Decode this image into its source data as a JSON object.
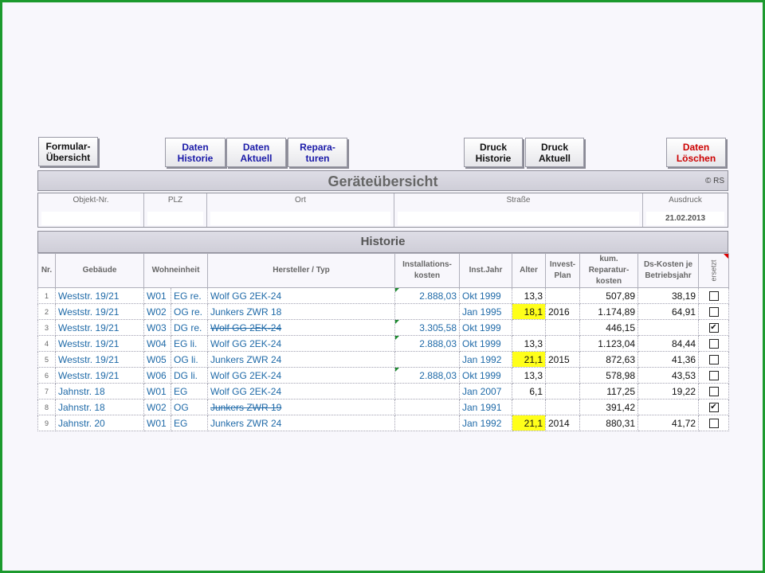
{
  "toolbar": {
    "formular": [
      "Formular-",
      "Übersicht"
    ],
    "daten_historie": [
      "Daten",
      "Historie"
    ],
    "daten_aktuell": [
      "Daten",
      "Aktuell"
    ],
    "reparaturen": [
      "Repara-",
      "turen"
    ],
    "druck_historie": [
      "Druck",
      "Historie"
    ],
    "druck_aktuell": [
      "Druck",
      "Aktuell"
    ],
    "daten_loeschen": [
      "Daten",
      "Löschen"
    ]
  },
  "title": "Geräteübersicht",
  "copyright": "© RS",
  "info": {
    "objekt_label": "Objekt-Nr.",
    "plz_label": "PLZ",
    "ort_label": "Ort",
    "strasse_label": "Straße",
    "ausdruck_label": "Ausdruck",
    "ausdruck_value": "21.02.2013"
  },
  "history_title": "Historie",
  "columns": {
    "nr": "Nr.",
    "gebaeude": "Gebäude",
    "wohneinheit": "Wohneinheit",
    "hersteller": "Hersteller / Typ",
    "installationskosten": [
      "Installations-",
      "kosten"
    ],
    "instjahr": "Inst.Jahr",
    "alter": "Alter",
    "invest": [
      "Invest-",
      "Plan"
    ],
    "kum": [
      "kum.",
      "Reparatur-",
      "kosten"
    ],
    "ds": [
      "Ds-Kosten je",
      "Betriebsjahr"
    ],
    "ersetzt": "ersetzt"
  },
  "rows": [
    {
      "nr": "1",
      "gebaeude": "Weststr. 19/21",
      "we": "W01",
      "lage": "EG re.",
      "hersteller": "Wolf GG 2EK-24",
      "strike": false,
      "install": "2.888,03",
      "instjahr": "Okt 1999",
      "alter": "13,3",
      "alter_hl": false,
      "invest": "",
      "kum": "507,89",
      "ds": "38,19",
      "ersetzt": false
    },
    {
      "nr": "2",
      "gebaeude": "Weststr. 19/21",
      "we": "W02",
      "lage": "OG re.",
      "hersteller": "Junkers ZWR 18",
      "strike": false,
      "install": "",
      "instjahr": "Jan 1995",
      "alter": "18,1",
      "alter_hl": true,
      "invest": "2016",
      "kum": "1.174,89",
      "ds": "64,91",
      "ersetzt": false
    },
    {
      "nr": "3",
      "gebaeude": "Weststr. 19/21",
      "we": "W03",
      "lage": "DG re.",
      "hersteller": "Wolf GG 2EK-24",
      "strike": true,
      "install": "3.305,58",
      "instjahr": "Okt 1999",
      "alter": "",
      "alter_hl": false,
      "invest": "",
      "kum": "446,15",
      "ds": "",
      "ersetzt": true
    },
    {
      "nr": "4",
      "gebaeude": "Weststr. 19/21",
      "we": "W04",
      "lage": "EG li.",
      "hersteller": "Wolf GG 2EK-24",
      "strike": false,
      "install": "2.888,03",
      "instjahr": "Okt 1999",
      "alter": "13,3",
      "alter_hl": false,
      "invest": "",
      "kum": "1.123,04",
      "ds": "84,44",
      "ersetzt": false
    },
    {
      "nr": "5",
      "gebaeude": "Weststr. 19/21",
      "we": "W05",
      "lage": "OG li.",
      "hersteller": "Junkers ZWR 24",
      "strike": false,
      "install": "",
      "instjahr": "Jan 1992",
      "alter": "21,1",
      "alter_hl": true,
      "invest": "2015",
      "kum": "872,63",
      "ds": "41,36",
      "ersetzt": false
    },
    {
      "nr": "6",
      "gebaeude": "Weststr. 19/21",
      "we": "W06",
      "lage": "DG li.",
      "hersteller": "Wolf GG 2EK-24",
      "strike": false,
      "install": "2.888,03",
      "instjahr": "Okt 1999",
      "alter": "13,3",
      "alter_hl": false,
      "invest": "",
      "kum": "578,98",
      "ds": "43,53",
      "ersetzt": false
    },
    {
      "nr": "7",
      "gebaeude": "Jahnstr. 18",
      "we": "W01",
      "lage": "EG",
      "hersteller": "Wolf GG 2EK-24",
      "strike": false,
      "install": "",
      "instjahr": "Jan 2007",
      "alter": "6,1",
      "alter_hl": false,
      "invest": "",
      "kum": "117,25",
      "ds": "19,22",
      "ersetzt": false
    },
    {
      "nr": "8",
      "gebaeude": "Jahnstr. 18",
      "we": "W02",
      "lage": "OG",
      "hersteller": "Junkers ZWR 19",
      "strike": true,
      "install": "",
      "instjahr": "Jan 1991",
      "alter": "",
      "alter_hl": false,
      "invest": "",
      "kum": "391,42",
      "ds": "",
      "ersetzt": true
    },
    {
      "nr": "9",
      "gebaeude": "Jahnstr. 20",
      "we": "W01",
      "lage": "EG",
      "hersteller": "Junkers ZWR 24",
      "strike": false,
      "install": "",
      "instjahr": "Jan 1992",
      "alter": "21,1",
      "alter_hl": true,
      "invest": "2014",
      "kum": "880,31",
      "ds": "41,72",
      "ersetzt": false
    }
  ],
  "colors": {
    "border": "#1c9a2e",
    "highlight": "#ffff1a",
    "link": "#1f6aa8",
    "button_blue": "#1a1aa8",
    "button_red": "#cc0000"
  }
}
